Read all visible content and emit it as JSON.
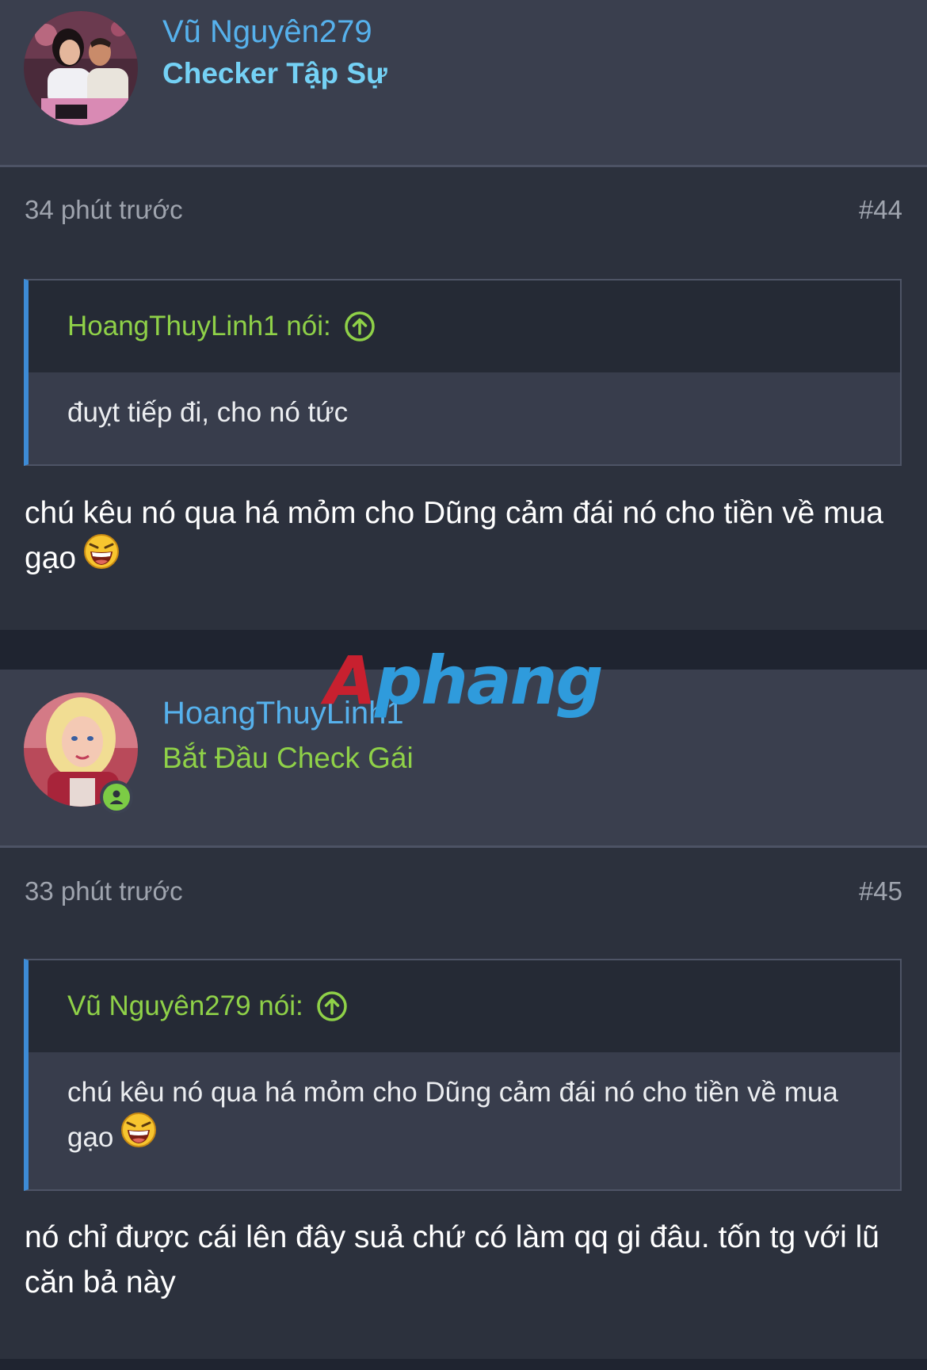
{
  "colors": {
    "username": "#56b1ec",
    "rank_checker": "#74d1f5",
    "rank_green": "#8fd148",
    "quote_author": "#8fd148",
    "quote_border": "#3d8bd6",
    "online": "#7ccc45"
  },
  "posts": [
    {
      "author": "Vũ Nguyên279",
      "rank": "Checker Tập Sự",
      "time": "34 phút trước",
      "number": "#44",
      "quote": {
        "author_label": "HoangThuyLinh1 nói:",
        "icon": "arrow-up-circle-icon",
        "text": "đuỵt tiếp đi, cho nó tức"
      },
      "message": "chú kêu nó qua há mỏm cho Dũng cảm đái nó cho tiền về mua gạo",
      "emoji": "laughing-emoji-icon"
    },
    {
      "author": "HoangThuyLinh1",
      "rank": "Bắt Đầu Check Gái",
      "online": true,
      "time": "33 phút trước",
      "number": "#45",
      "quote": {
        "author_label": "Vũ Nguyên279 nói:",
        "icon": "arrow-up-circle-icon",
        "text": "chú kêu nó qua há mỏm cho Dũng cảm đái nó cho tiền về mua gạo",
        "emoji": "laughing-emoji-icon"
      },
      "message": "nó chỉ được cái lên đây suả chứ có làm qq gi đâu. tốn tg với lũ căn bả này"
    }
  ],
  "watermark": {
    "first": "A",
    "rest": "phang"
  }
}
